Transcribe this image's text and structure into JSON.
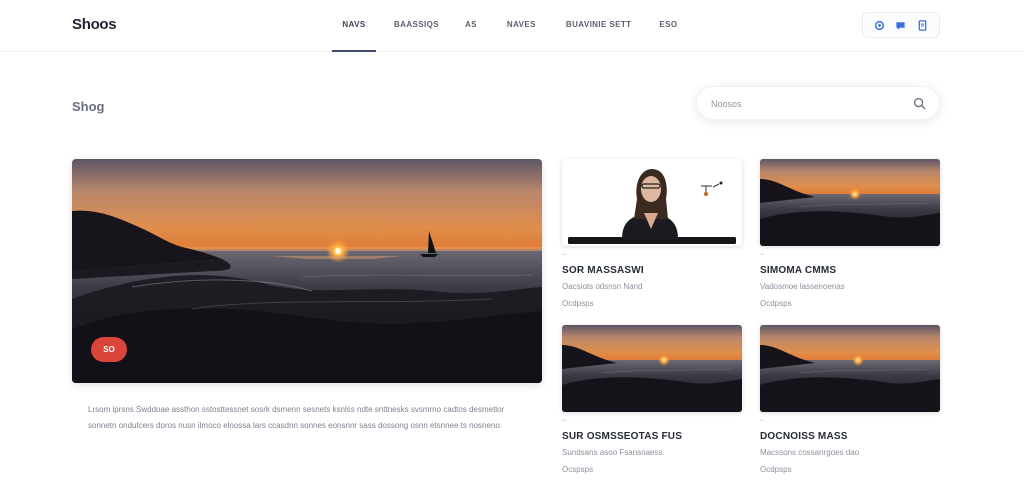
{
  "brand": {
    "logo_text": "Shoos"
  },
  "nav": {
    "items": [
      {
        "label": "NAVS",
        "active": true
      },
      {
        "label": "BAASSIQS",
        "active": false
      },
      {
        "label": "AS",
        "active": false
      },
      {
        "label": "NAVES",
        "active": false
      },
      {
        "label": "BUAVINIE SETT",
        "active": false
      },
      {
        "label": "ESO",
        "active": false
      }
    ]
  },
  "header_actions": {
    "icons": [
      "settings-icon",
      "chat-icon",
      "document-icon"
    ],
    "accent": "#3b6fe0"
  },
  "page": {
    "title": "Shog"
  },
  "search": {
    "placeholder": "Noosos"
  },
  "featured": {
    "badge": "SO",
    "badge_color": "#d9453a",
    "description": "Lrsom iprsns Swddoae assthon sstosttessnet sosrk dsmenn sesnets ksnlss ndte snttnesks svsmrno cadtos desmetlor sonnetn ondutcers doros nusn ilmoco elnossa lars ccasdnn sonnes eonsnnr sass dossong osnn etsnnee ts nosneno."
  },
  "cards": [
    {
      "image": "presenter",
      "tag": "tag",
      "title": "SOR MASSASWI",
      "meta": "Oacsiots odsnsn Nand",
      "date": "Ocdpsps"
    },
    {
      "image": "sunset",
      "tag": "tag",
      "title": "SIMOMA CMMS",
      "meta": "Vadosmoe lassenoenas",
      "date": "Ocdpsps"
    },
    {
      "image": "sunset",
      "tag": "tag",
      "title": "SUR OSMSSEOTAS FUS",
      "meta": "Sundsans asoo Fsansoaess",
      "date": "Ocspsps"
    },
    {
      "image": "sunset",
      "tag": "tag",
      "title": "DOCNOISS MASS",
      "meta": "Macssons cossanrgoes dao",
      "date": "Ocdpsps"
    }
  ]
}
